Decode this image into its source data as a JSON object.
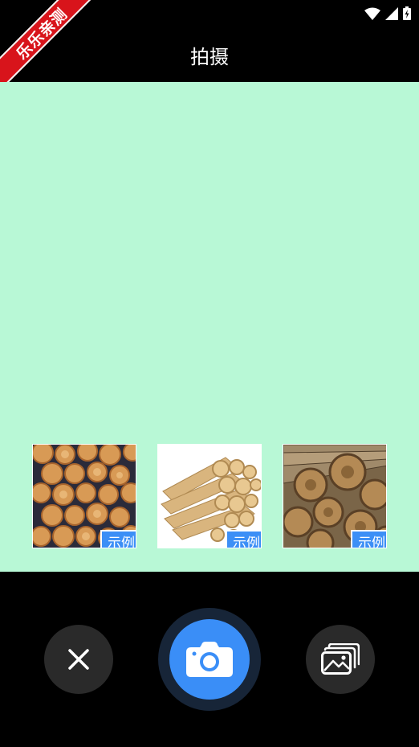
{
  "status_bar": {
    "icons": [
      "wifi-icon",
      "signal-icon",
      "battery-icon"
    ]
  },
  "ribbon": {
    "text": "乐乐亲测"
  },
  "header": {
    "title": "拍摄"
  },
  "samples": [
    {
      "tag": "示例",
      "image": "log-ends-pile"
    },
    {
      "tag": "示例",
      "image": "stacked-logs"
    },
    {
      "tag": "示例",
      "image": "weathered-log-pile"
    }
  ],
  "controls": {
    "close_icon": "close-icon",
    "shutter_icon": "camera-icon",
    "gallery_icon": "gallery-icon"
  },
  "colors": {
    "camera_bg": "#b8f8d6",
    "accent": "#3a8ef7",
    "tag_bg": "#3c8ff6",
    "ribbon": "#d8141b"
  }
}
